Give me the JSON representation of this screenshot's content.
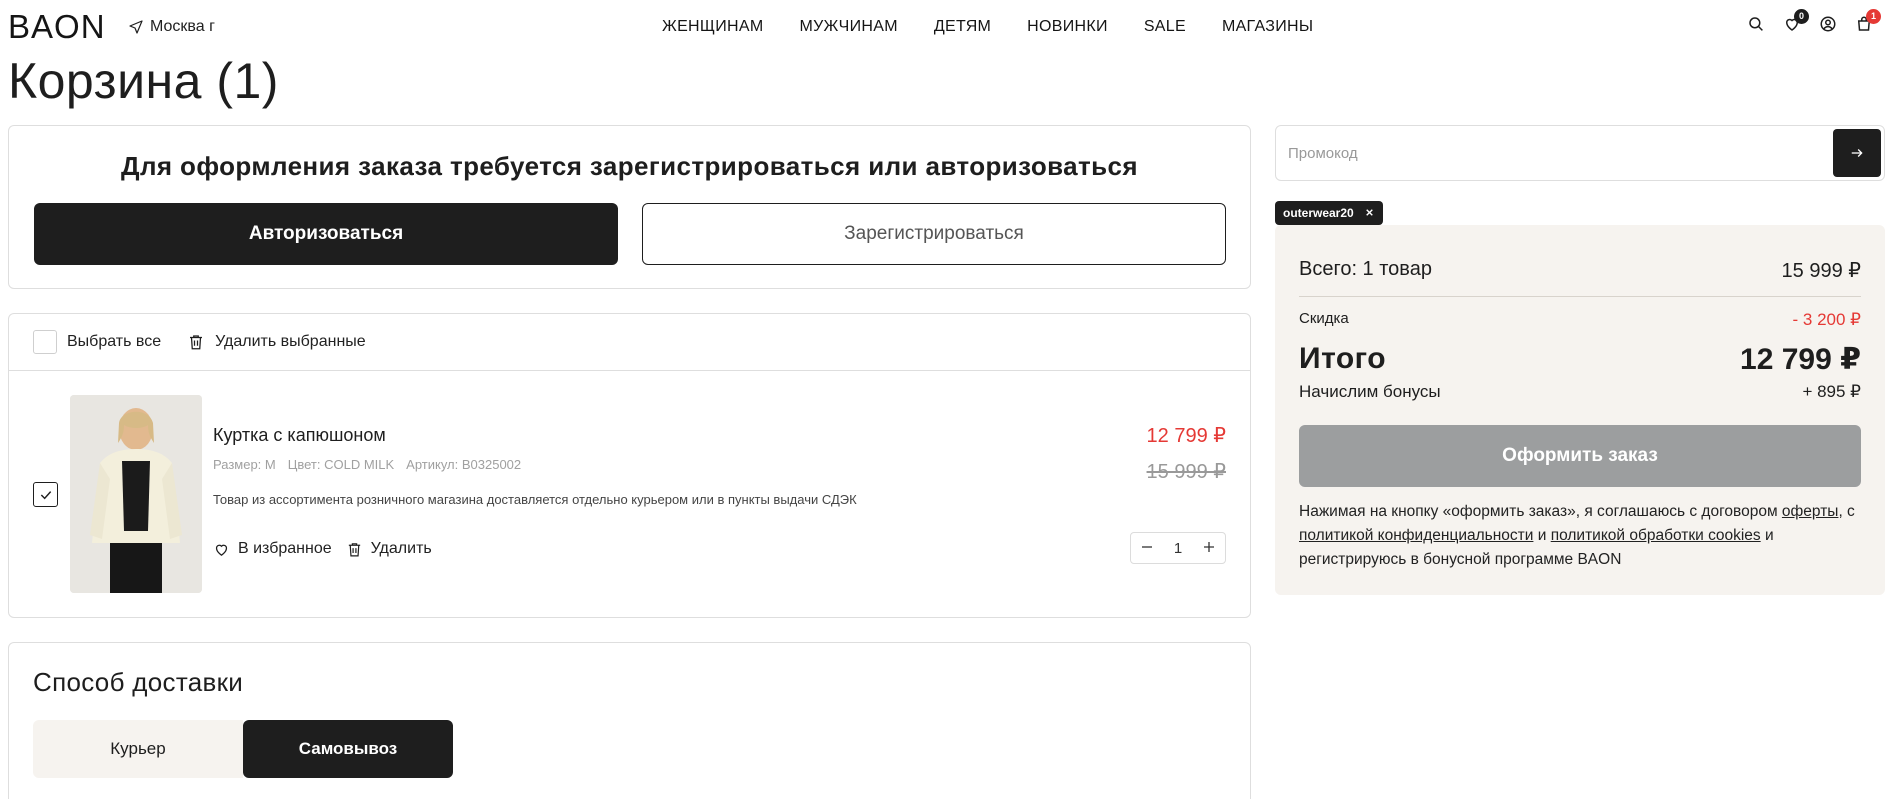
{
  "header": {
    "logo": "BAON",
    "city": "Москва г",
    "nav": [
      "ЖЕНЩИНАМ",
      "МУЖЧИНАМ",
      "ДЕТЯМ",
      "НОВИНКИ",
      "SALE",
      "МАГАЗИНЫ"
    ],
    "favorites_count": "0",
    "cart_count": "1"
  },
  "page_title": "Корзина (1)",
  "auth": {
    "title": "Для оформления заказа требуется зарегистрироваться или авторизоваться",
    "login_label": "Авторизоваться",
    "register_label": "Зарегистрироваться"
  },
  "cart": {
    "select_all_label": "Выбрать все",
    "delete_selected_label": "Удалить выбранные",
    "item": {
      "name": "Куртка с капюшоном",
      "size": "Размер: M",
      "color": "Цвет: COLD MILK",
      "article": "Артикул: B0325002",
      "note": "Товар из ассортимента розничного магазина доставляется отдельно курьером или в пункты выдачи СДЭК",
      "favorite_label": "В избранное",
      "delete_label": "Удалить",
      "price_new": "12 799 ₽",
      "price_old": "15 999 ₽",
      "quantity": "1"
    }
  },
  "delivery": {
    "title": "Способ доставки",
    "options": [
      "Курьер",
      "Самовывоз"
    ],
    "selected": "Самовывоз"
  },
  "promo": {
    "placeholder": "Промокод",
    "applied_code": "outerwear20"
  },
  "summary": {
    "total_label": "Всего: 1 товар",
    "total_value": "15 999 ₽",
    "discount_label": "Скидка",
    "discount_value": "- 3 200 ₽",
    "final_label": "Итого",
    "final_value": "12 799 ₽",
    "bonus_label": "Начислим бонусы",
    "bonus_value": "+ 895 ₽",
    "checkout_label": "Оформить заказ",
    "terms_part1": "Нажимая на кнопку «оформить заказ», я соглашаюсь с договором ",
    "terms_link_offer": "оферты",
    "terms_part2": ", с ",
    "terms_link_privacy": "политикой конфиденциальности",
    "terms_part3": " и ",
    "terms_link_cookies": "политикой обработки cookies",
    "terms_part4": " и регистрирую­сь в бонусной программе BAON"
  },
  "colors": {
    "dark": "#1e1e1e",
    "sale_red": "#e53935",
    "summary_bg": "#f6f3ef",
    "disabled_button": "#9c9e9f"
  },
  "icons": [
    "location-arrow-icon",
    "search-icon",
    "heart-icon",
    "user-icon",
    "bag-icon",
    "trash-icon",
    "check-icon",
    "minus-icon",
    "plus-icon",
    "arrow-right-icon",
    "close-icon"
  ]
}
